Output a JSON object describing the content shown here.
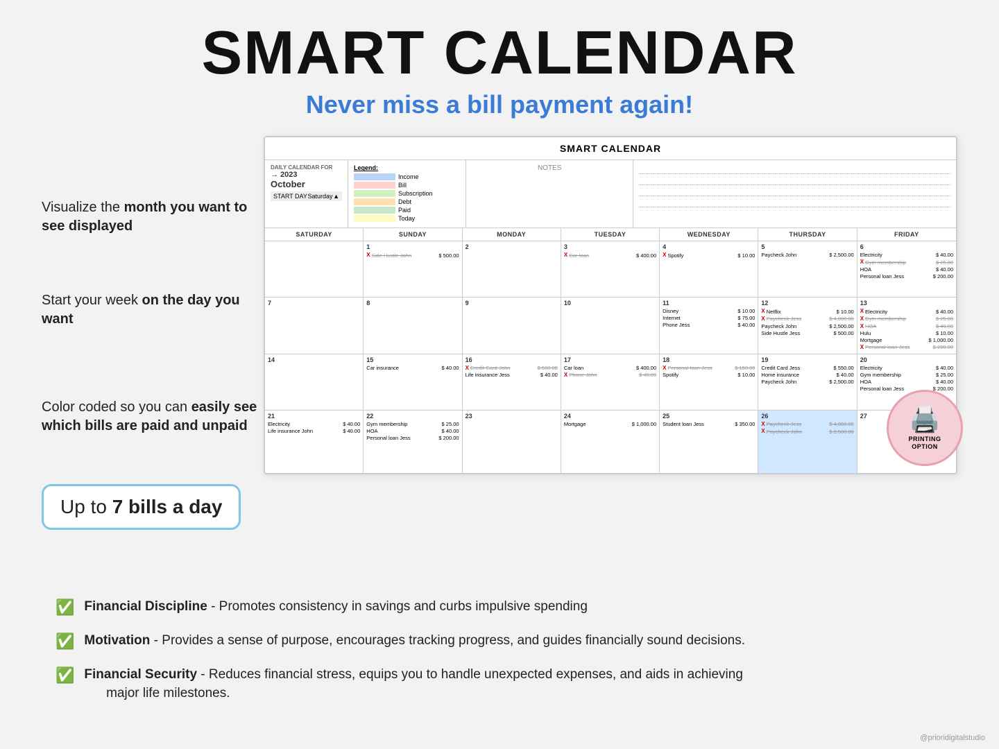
{
  "header": {
    "main_title": "SMART CALENDAR",
    "subtitle": "Never miss a bill payment again!"
  },
  "calendar": {
    "title": "SMART CALENDAR",
    "info": {
      "label": "DAILY CALENDAR FOR",
      "year": "→ 2023",
      "month": "October",
      "start_day_label": "START DAY",
      "start_day_value": "Saturday"
    },
    "legend": {
      "title": "Legend:",
      "items": [
        {
          "label": "Income",
          "color": "#b8d4f8"
        },
        {
          "label": "Bill",
          "color": "#ffd0d0"
        },
        {
          "label": "Subscription",
          "color": "#d0f0c0"
        },
        {
          "label": "Debt",
          "color": "#ffe0b0"
        },
        {
          "label": "Paid",
          "color": "#c8e6c9"
        },
        {
          "label": "Today",
          "color": "#fff9c4"
        }
      ]
    },
    "notes_label": "NOTES",
    "day_headers": [
      "SATURDAY",
      "SUNDAY",
      "MONDAY",
      "TUESDAY",
      "WEDNESDAY",
      "THURSDAY",
      "FRIDAY"
    ]
  },
  "annotations": {
    "a1": "Visualize the month you want to see displayed",
    "a1_bold": "month you want to see displayed",
    "a2_prefix": "Start your week ",
    "a2_bold": "on  the day you want",
    "a3_prefix": "Color coded so you can ",
    "a3_bold": "easily see which bills are paid and unpaid",
    "a4_prefix": "Up to ",
    "a4_bold": "7 bills a day"
  },
  "features": [
    {
      "bold": "Financial Discipline",
      "text": " - Promotes consistency in savings and curbs impulsive spending"
    },
    {
      "bold": "Motivation",
      "text": " - Provides a sense of purpose, encourages tracking progress, and guides financially sound decisions."
    },
    {
      "bold": "Financial Security",
      "text": " - Reduces financial stress, equips you to handle unexpected expenses, and aids in achieving major life milestones."
    }
  ],
  "printing": {
    "line1": "PRINTING",
    "line2": "OPTION"
  },
  "watermark": "@prioridigitalstudio"
}
